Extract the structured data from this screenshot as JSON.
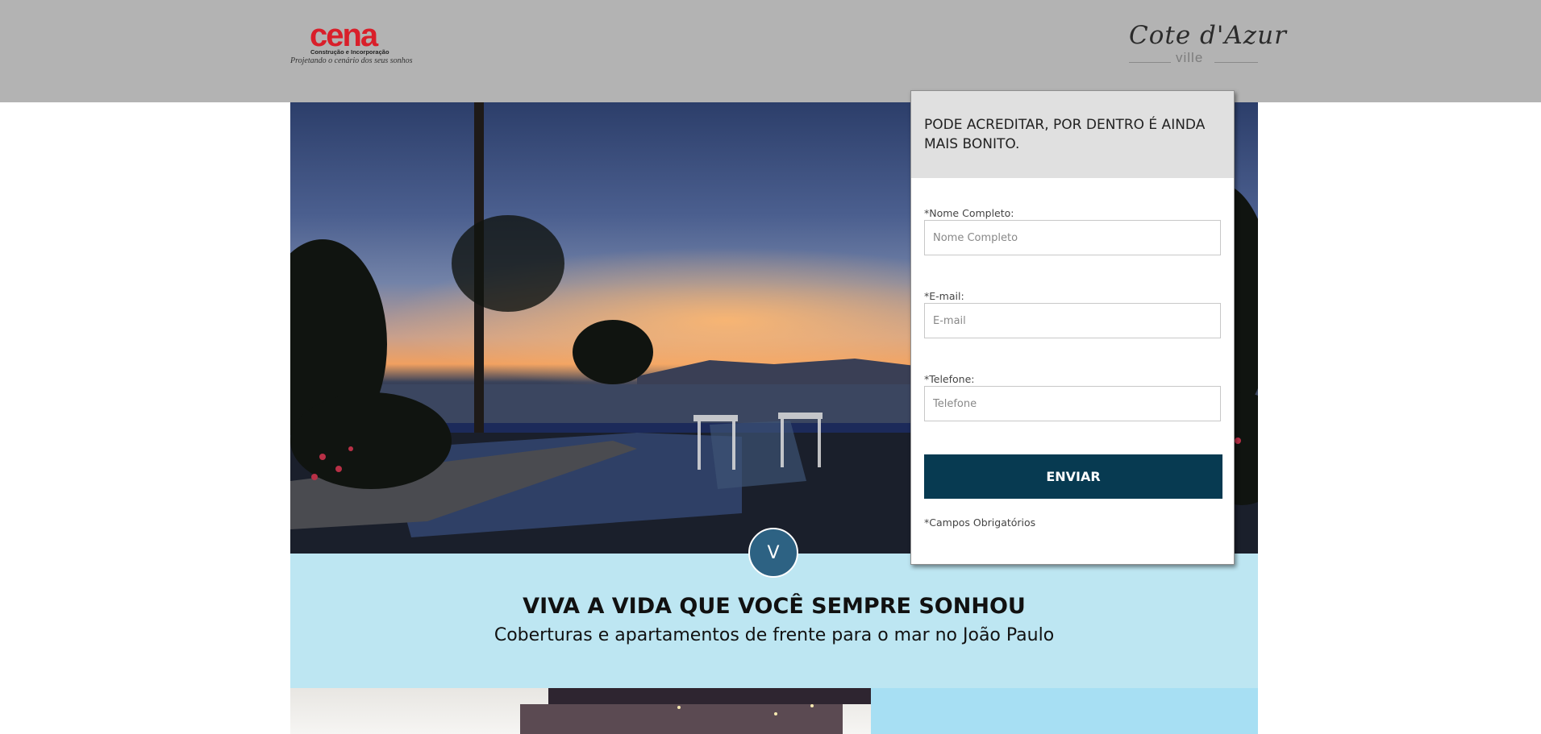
{
  "header": {
    "brand_left": {
      "name": "cena",
      "tagline": "Construção e Incorporação",
      "slogan": "Projetando o cenário dos seus sonhos"
    },
    "brand_right": {
      "name": "Cote d'Azur",
      "sub": "ville"
    }
  },
  "form": {
    "headline": "PODE ACREDITAR, POR DENTRO É AINDA MAIS BONITO.",
    "fields": [
      {
        "label": "*Nome Completo:",
        "placeholder": "Nome Completo",
        "value": ""
      },
      {
        "label": "*E-mail:",
        "placeholder": "E-mail",
        "value": ""
      },
      {
        "label": "*Telefone:",
        "placeholder": "Telefone",
        "value": ""
      }
    ],
    "submit_label": "ENVIAR",
    "note": "*Campos Obrigatórios"
  },
  "scroll_button": {
    "icon": "chevron-down-icon",
    "glyph": "V"
  },
  "section": {
    "title": "VIVA A VIDA QUE VOCÊ SEMPRE SONHOU",
    "subtitle": "Coberturas e apartamentos de frente para o mar no João Paulo"
  },
  "colors": {
    "topbar": "#b3b3b3",
    "accent_button": "#073a51",
    "band": "#bde6f2",
    "scroll_button": "#2d6283",
    "logo_red": "#d91f2a"
  }
}
